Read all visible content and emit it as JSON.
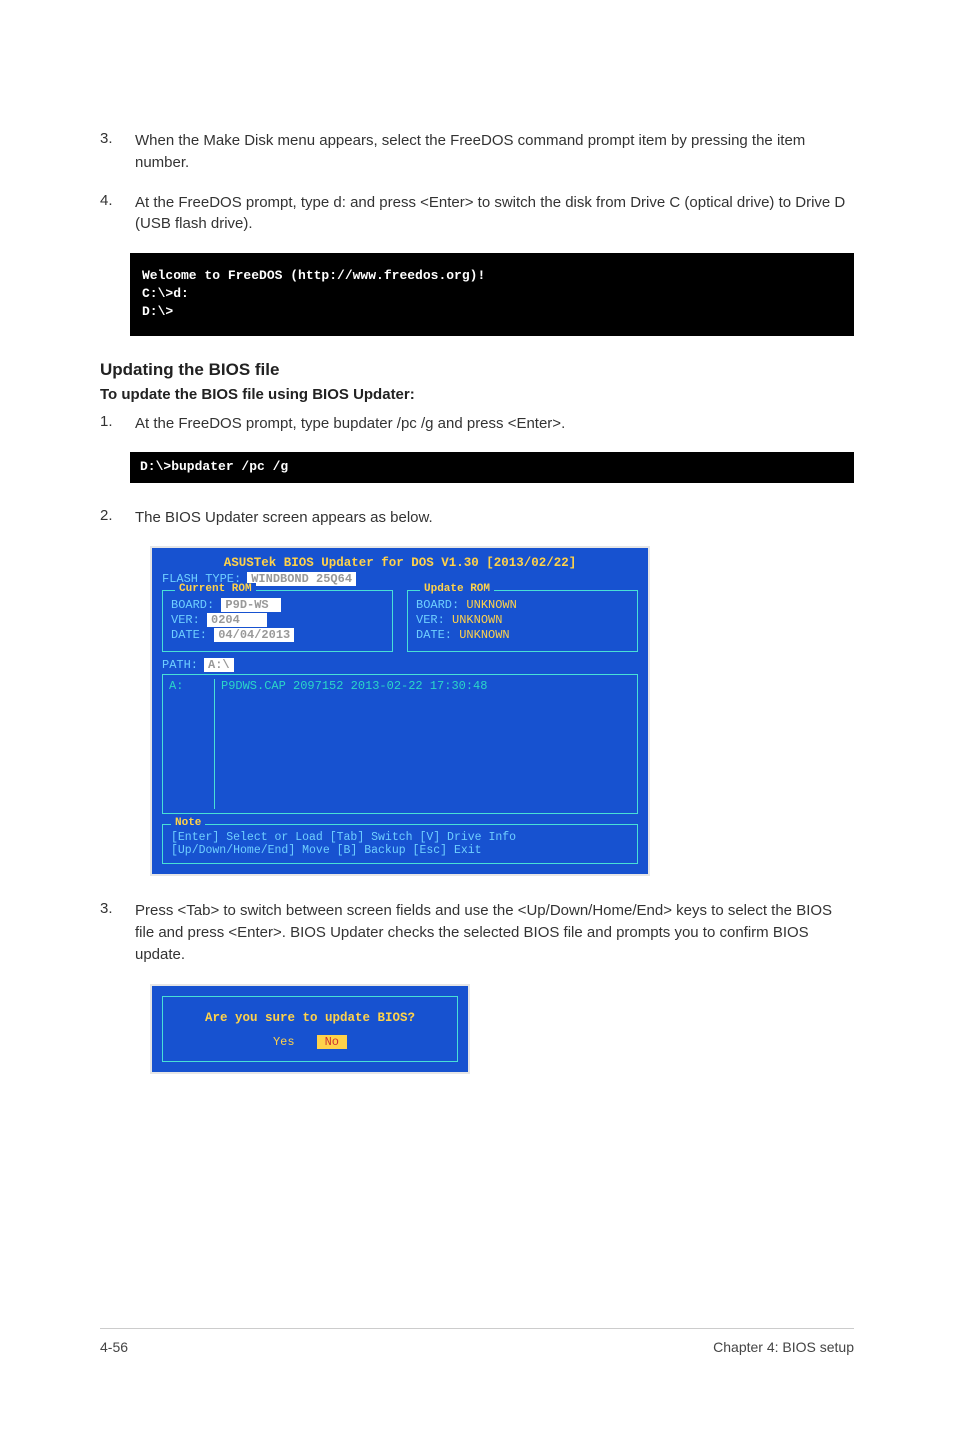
{
  "steps_a": [
    {
      "num": "3.",
      "text": "When the Make Disk menu appears, select the FreeDOS command prompt item by pressing the item number."
    },
    {
      "num": "4.",
      "text": "At the FreeDOS prompt, type d: and press <Enter> to switch the disk from Drive C (optical drive) to Drive D (USB flash drive)."
    }
  ],
  "terminal1": "Welcome to FreeDOS (http://www.freedos.org)!\nC:\\>d:\nD:\\>",
  "section_heading": "Updating the BIOS file",
  "section_sub": "To update the BIOS file using BIOS Updater:",
  "steps_b1": {
    "num": "1.",
    "text": "At the FreeDOS prompt, type bupdater /pc /g and press <Enter>."
  },
  "terminal2": "D:\\>bupdater /pc /g",
  "steps_b2": {
    "num": "2.",
    "text": "The BIOS Updater screen appears as below."
  },
  "bios": {
    "title": "ASUSTek BIOS Updater for DOS V1.30 [2013/02/22]",
    "flash_label": "FLASH TYPE:",
    "flash_val": "WINDBOND 25Q64",
    "current_legend": "Current ROM",
    "update_legend": "Update ROM",
    "cur": {
      "board_l": "BOARD:",
      "board_v": "P9D-WS",
      "ver_l": "VER:",
      "ver_v": "0204",
      "date_l": "DATE:",
      "date_v": "04/04/2013"
    },
    "upd": {
      "board_l": "BOARD:",
      "board_v": "UNKNOWN",
      "ver_l": "VER:",
      "ver_v": "UNKNOWN",
      "date_l": "DATE:",
      "date_v": "UNKNOWN"
    },
    "path_label": "PATH:",
    "path_val": "A:\\",
    "drive": "A:",
    "file_line": "P9DWS.CAP    2097152 2013-02-22 17:30:48",
    "note_legend": "Note",
    "note1": "[Enter] Select or Load    [Tab] Switch    [V] Drive Info",
    "note2": "[Up/Down/Home/End] Move   [B] Backup      [Esc] Exit"
  },
  "steps_b3": {
    "num": "3.",
    "text": "Press <Tab> to switch between screen fields and use the <Up/Down/Home/End> keys to select the BIOS file and press <Enter>. BIOS Updater checks the selected BIOS file and prompts you to confirm BIOS update."
  },
  "confirm": {
    "q": "Are you sure to update BIOS?",
    "yes": "Yes",
    "no": "No"
  },
  "footer": {
    "page": "4-56",
    "chapter": "Chapter 4: BIOS setup"
  }
}
